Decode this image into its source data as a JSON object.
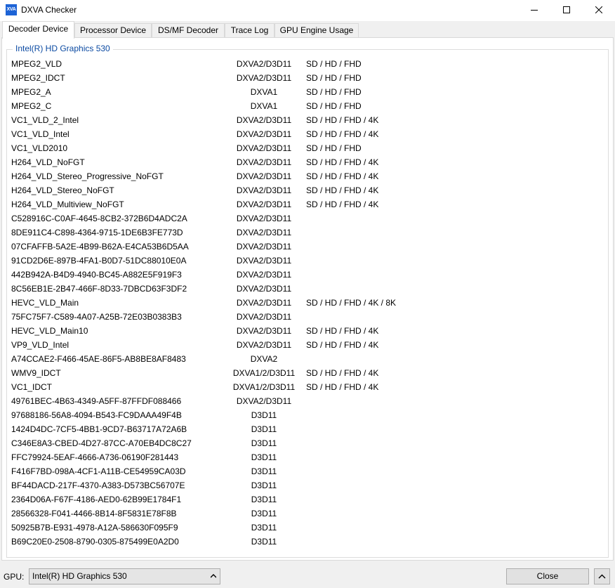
{
  "window": {
    "title": "DXVA Checker",
    "icon_text": "XVA",
    "icon_color": "#1d63d6"
  },
  "tabs": [
    {
      "label": "Decoder Device",
      "active": true
    },
    {
      "label": "Processor Device",
      "active": false
    },
    {
      "label": "DS/MF Decoder",
      "active": false
    },
    {
      "label": "Trace Log",
      "active": false
    },
    {
      "label": "GPU Engine Usage",
      "active": false
    }
  ],
  "group": {
    "title": "Intel(R) HD Graphics 530",
    "title_color": "#0b4aa2"
  },
  "decoders": [
    {
      "name": "MPEG2_VLD",
      "api": "DXVA2/D3D11",
      "res": "SD / HD / FHD"
    },
    {
      "name": "MPEG2_IDCT",
      "api": "DXVA2/D3D11",
      "res": "SD / HD / FHD"
    },
    {
      "name": "MPEG2_A",
      "api": "DXVA1",
      "res": "SD / HD / FHD"
    },
    {
      "name": "MPEG2_C",
      "api": "DXVA1",
      "res": "SD / HD / FHD"
    },
    {
      "name": "VC1_VLD_2_Intel",
      "api": "DXVA2/D3D11",
      "res": "SD / HD / FHD / 4K"
    },
    {
      "name": "VC1_VLD_Intel",
      "api": "DXVA2/D3D11",
      "res": "SD / HD / FHD / 4K"
    },
    {
      "name": "VC1_VLD2010",
      "api": "DXVA2/D3D11",
      "res": "SD / HD / FHD"
    },
    {
      "name": "H264_VLD_NoFGT",
      "api": "DXVA2/D3D11",
      "res": "SD / HD / FHD / 4K"
    },
    {
      "name": "H264_VLD_Stereo_Progressive_NoFGT",
      "api": "DXVA2/D3D11",
      "res": "SD / HD / FHD / 4K"
    },
    {
      "name": "H264_VLD_Stereo_NoFGT",
      "api": "DXVA2/D3D11",
      "res": "SD / HD / FHD / 4K"
    },
    {
      "name": "H264_VLD_Multiview_NoFGT",
      "api": "DXVA2/D3D11",
      "res": "SD / HD / FHD / 4K"
    },
    {
      "name": "C528916C-C0AF-4645-8CB2-372B6D4ADC2A",
      "api": "DXVA2/D3D11",
      "res": ""
    },
    {
      "name": "8DE911C4-C898-4364-9715-1DE6B3FE773D",
      "api": "DXVA2/D3D11",
      "res": ""
    },
    {
      "name": "07CFAFFB-5A2E-4B99-B62A-E4CA53B6D5AA",
      "api": "DXVA2/D3D11",
      "res": ""
    },
    {
      "name": "91CD2D6E-897B-4FA1-B0D7-51DC88010E0A",
      "api": "DXVA2/D3D11",
      "res": ""
    },
    {
      "name": "442B942A-B4D9-4940-BC45-A882E5F919F3",
      "api": "DXVA2/D3D11",
      "res": ""
    },
    {
      "name": "8C56EB1E-2B47-466F-8D33-7DBCD63F3DF2",
      "api": "DXVA2/D3D11",
      "res": ""
    },
    {
      "name": "HEVC_VLD_Main",
      "api": "DXVA2/D3D11",
      "res": "SD / HD / FHD / 4K / 8K"
    },
    {
      "name": "75FC75F7-C589-4A07-A25B-72E03B0383B3",
      "api": "DXVA2/D3D11",
      "res": ""
    },
    {
      "name": "HEVC_VLD_Main10",
      "api": "DXVA2/D3D11",
      "res": "SD / HD / FHD / 4K"
    },
    {
      "name": "VP9_VLD_Intel",
      "api": "DXVA2/D3D11",
      "res": "SD / HD / FHD / 4K"
    },
    {
      "name": "A74CCAE2-F466-45AE-86F5-AB8BE8AF8483",
      "api": "DXVA2",
      "res": ""
    },
    {
      "name": "WMV9_IDCT",
      "api": "DXVA1/2/D3D11",
      "res": "SD / HD / FHD / 4K"
    },
    {
      "name": "VC1_IDCT",
      "api": "DXVA1/2/D3D11",
      "res": "SD / HD / FHD / 4K"
    },
    {
      "name": "49761BEC-4B63-4349-A5FF-87FFDF088466",
      "api": "DXVA2/D3D11",
      "res": ""
    },
    {
      "name": "97688186-56A8-4094-B543-FC9DAAA49F4B",
      "api": "D3D11",
      "res": ""
    },
    {
      "name": "1424D4DC-7CF5-4BB1-9CD7-B63717A72A6B",
      "api": "D3D11",
      "res": ""
    },
    {
      "name": "C346E8A3-CBED-4D27-87CC-A70EB4DC8C27",
      "api": "D3D11",
      "res": ""
    },
    {
      "name": "FFC79924-5EAF-4666-A736-06190F281443",
      "api": "D3D11",
      "res": ""
    },
    {
      "name": "F416F7BD-098A-4CF1-A11B-CE54959CA03D",
      "api": "D3D11",
      "res": ""
    },
    {
      "name": "BF44DACD-217F-4370-A383-D573BC56707E",
      "api": "D3D11",
      "res": ""
    },
    {
      "name": "2364D06A-F67F-4186-AED0-62B99E1784F1",
      "api": "D3D11",
      "res": ""
    },
    {
      "name": "28566328-F041-4466-8B14-8F5831E78F8B",
      "api": "D3D11",
      "res": ""
    },
    {
      "name": "50925B7B-E931-4978-A12A-586630F095F9",
      "api": "D3D11",
      "res": ""
    },
    {
      "name": "B69C20E0-2508-8790-0305-875499E0A2D0",
      "api": "D3D11",
      "res": ""
    }
  ],
  "footer": {
    "gpu_label": "GPU:",
    "gpu_selected": "Intel(R) HD Graphics 530",
    "close_label": "Close"
  }
}
